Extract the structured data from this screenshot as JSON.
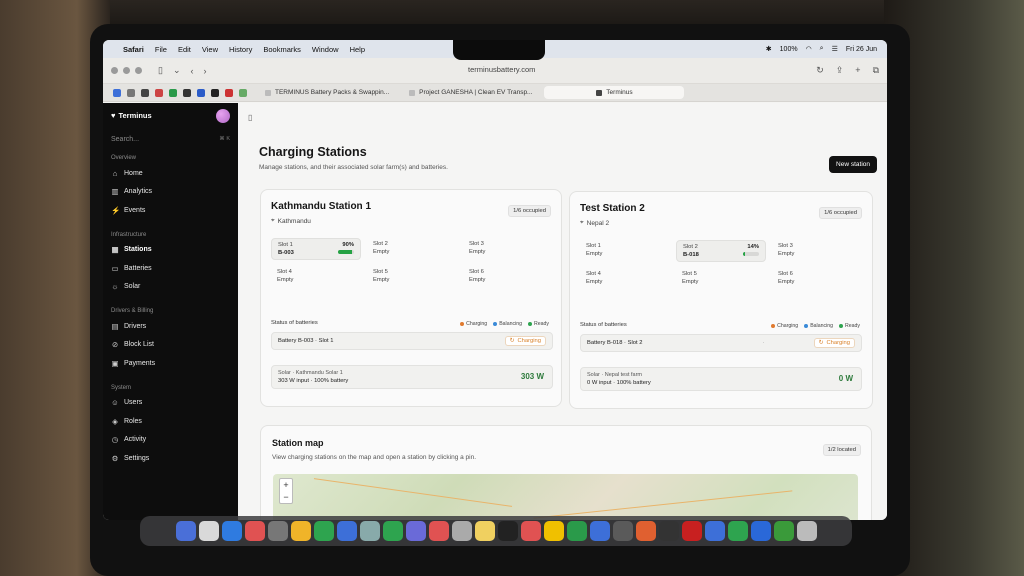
{
  "menubar": {
    "app": "Safari",
    "items": [
      "File",
      "Edit",
      "View",
      "History",
      "Bookmarks",
      "Window",
      "Help"
    ],
    "battery": "100%",
    "clock": "Fri 26 Jun"
  },
  "browser": {
    "url": "terminusbattery.com",
    "tabs": [
      {
        "label": "TERMINUS Battery Packs & Swappin..."
      },
      {
        "label": "Project GANESHA | Clean EV Transp..."
      },
      {
        "label": "Terminus"
      }
    ]
  },
  "sidebar": {
    "brand": "Terminus",
    "search_placeholder": "Search...",
    "search_shortcut": "⌘ K",
    "sections": [
      {
        "title": "Overview",
        "items": [
          {
            "label": "Home",
            "icon": "⌂"
          },
          {
            "label": "Analytics",
            "icon": "▥"
          },
          {
            "label": "Events",
            "icon": "⚡"
          }
        ]
      },
      {
        "title": "Infrastructure",
        "items": [
          {
            "label": "Stations",
            "icon": "▦",
            "active": true
          },
          {
            "label": "Batteries",
            "icon": "▭"
          },
          {
            "label": "Solar",
            "icon": "☼"
          }
        ]
      },
      {
        "title": "Drivers & Billing",
        "items": [
          {
            "label": "Drivers",
            "icon": "▤"
          },
          {
            "label": "Block List",
            "icon": "⊘"
          },
          {
            "label": "Payments",
            "icon": "▣"
          }
        ]
      },
      {
        "title": "System",
        "items": [
          {
            "label": "Users",
            "icon": "☺"
          },
          {
            "label": "Roles",
            "icon": "◈"
          },
          {
            "label": "Activity",
            "icon": "◷"
          },
          {
            "label": "Settings",
            "icon": "⚙"
          }
        ]
      }
    ]
  },
  "page": {
    "title": "Charging Stations",
    "subtitle": "Manage stations, and their associated solar farm(s) and batteries.",
    "new_button": "New station"
  },
  "status_legend": [
    {
      "label": "Charging",
      "color": "#e07a2e"
    },
    {
      "label": "Balancing",
      "color": "#3a8ad8"
    },
    {
      "label": "Ready",
      "color": "#2ea44f"
    }
  ],
  "stations": [
    {
      "name": "Kathmandu Station 1",
      "location": "Kathmandu",
      "occupied": "1/6 occupied",
      "slots": [
        {
          "label": "Slot 1",
          "value": "B-003",
          "filled": true,
          "pct": "90%",
          "charge": 0.9
        },
        {
          "label": "Slot 2",
          "value": "Empty",
          "filled": false
        },
        {
          "label": "Slot 3",
          "value": "Empty",
          "filled": false
        },
        {
          "label": "Slot 4",
          "value": "Empty",
          "filled": false
        },
        {
          "label": "Slot 5",
          "value": "Empty",
          "filled": false
        },
        {
          "label": "Slot 6",
          "value": "Empty",
          "filled": false
        }
      ],
      "status_label": "Status of batteries",
      "battery": {
        "label": "Battery B-003 · Slot 1",
        "status": "Charging"
      },
      "solar": {
        "name": "Solar · Kathmandu Solar 1",
        "detail": "303 W input · 100% battery",
        "watts": "303 W"
      }
    },
    {
      "name": "Test Station 2",
      "location": "Nepal 2",
      "occupied": "1/6 occupied",
      "slots": [
        {
          "label": "Slot 1",
          "value": "Empty",
          "filled": false
        },
        {
          "label": "Slot 2",
          "value": "B-018",
          "filled": true,
          "pct": "14%",
          "charge": 0.14
        },
        {
          "label": "Slot 3",
          "value": "Empty",
          "filled": false
        },
        {
          "label": "Slot 4",
          "value": "Empty",
          "filled": false
        },
        {
          "label": "Slot 5",
          "value": "Empty",
          "filled": false
        },
        {
          "label": "Slot 6",
          "value": "Empty",
          "filled": false
        }
      ],
      "status_label": "Status of batteries",
      "battery": {
        "label": "Battery B-018 · Slot 2",
        "status": "Charging",
        "sep": "·"
      },
      "solar": {
        "name": "Solar · Nepal test farm",
        "detail": "0 W input · 100% battery",
        "watts": "0 W"
      }
    }
  ],
  "map": {
    "title": "Station map",
    "subtitle": "View charging stations on the map and open a station by clicking a pin.",
    "located": "1/2 located",
    "zoom_in": "+",
    "zoom_out": "−"
  }
}
